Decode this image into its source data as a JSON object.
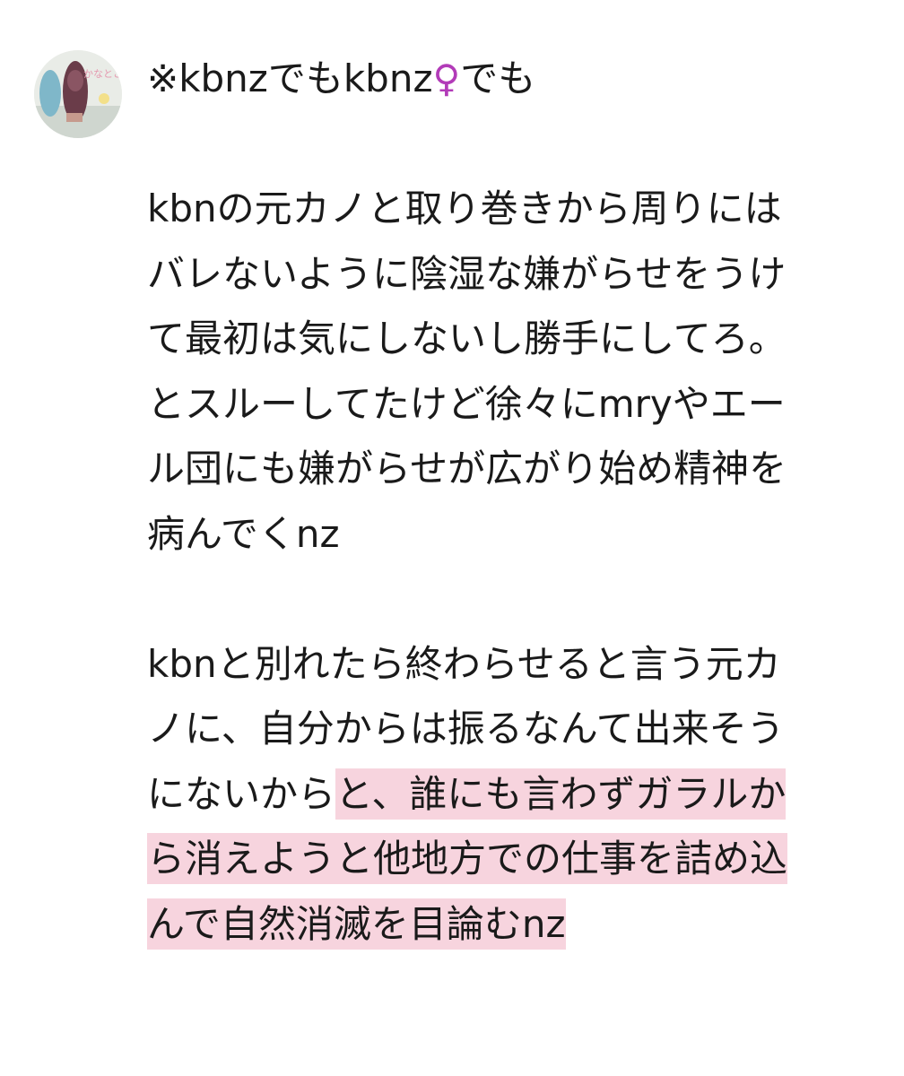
{
  "post": {
    "title_prefix": "※kbnzでもkbnz",
    "title_symbol": "♀",
    "title_suffix": "でも",
    "p1": [
      "kbnの元カノと取り巻きから周りには",
      "バレないように陰湿な嫌がらせをうけ",
      "て最初は気にしないし勝手にしてろ。",
      "とスルーしてたけど徐々にmryやエー",
      "ル団にも嫌がらせが広がり始め精神を",
      "病んでくnz"
    ],
    "p2": {
      "line1": "kbnと別れたら終わらせると言う元カ",
      "line2": "ノに、自分からは振るなんて出来そう",
      "line3_plain": "にないから",
      "line3_highlight": "と、誰にも言わずガラルか",
      "line4_highlight": "ら消えようと他地方での仕事を詰め込",
      "line5_highlight": "んで自然消滅を目論むnz"
    },
    "avatar_text": "かなとこ"
  },
  "colors": {
    "highlight": "#f7d4de",
    "symbol": "#b23bb8",
    "text": "#1a1a1a"
  }
}
